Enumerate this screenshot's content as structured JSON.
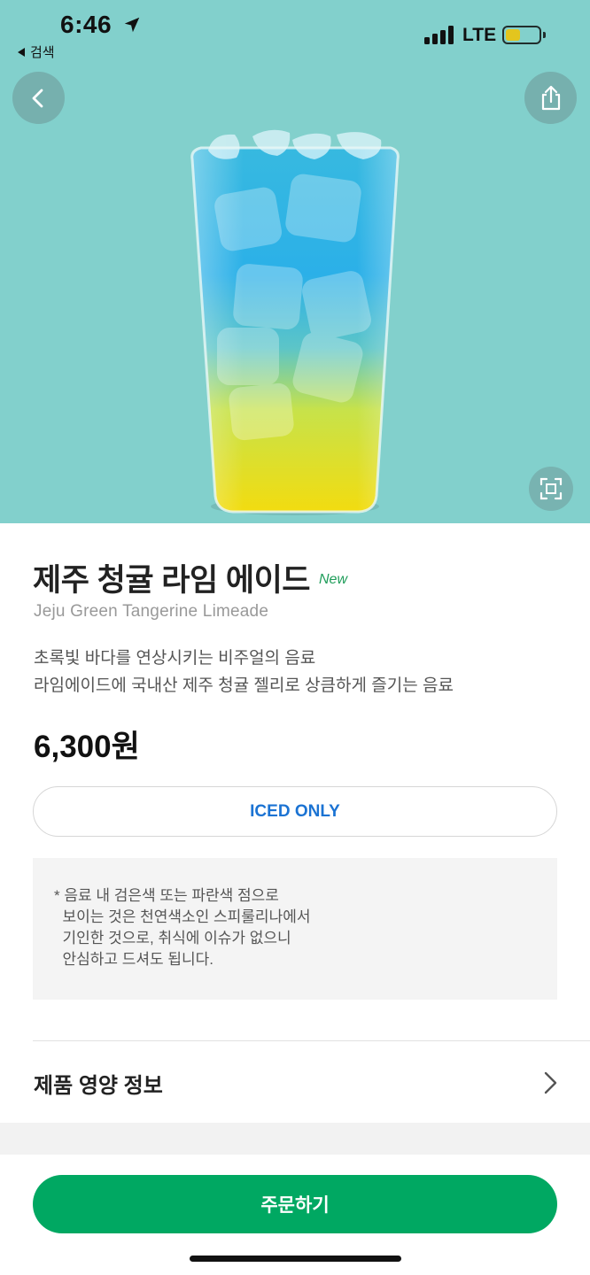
{
  "status_bar": {
    "time": "6:46",
    "back_app_label": "검색",
    "network": "LTE",
    "battery_level": 0.45,
    "battery_color": "#f5c400"
  },
  "header": {
    "back_icon": "chevron-left-icon",
    "share_icon": "share-icon",
    "zoom_icon": "fullscreen-icon",
    "hero_background": "#82d0cc"
  },
  "product": {
    "name_ko": "제주 청귤 라임 에이드",
    "badge": "New",
    "name_en": "Jeju Green Tangerine Limeade",
    "description_line1": "초록빛 바다를 연상시키는 비주얼의 음료",
    "description_line2": "라임에이드에 국내산 제주 청귤 젤리로 상큼하게 즐기는 음료",
    "price": "6,300원",
    "temperature_option": "ICED ONLY",
    "notice": "* 음료 내 검은색 또는 파란색 점으로\n  보이는 것은 천연색소인 스피룰리나에서\n  기인한 것으로, 취식에 이슈가 없으니\n  안심하고 드셔도 됩니다."
  },
  "nutrition": {
    "label": "제품 영양 정보",
    "chevron_icon": "chevron-right-icon"
  },
  "footer": {
    "order_button_label": "주문하기",
    "accent_color": "#00a862"
  }
}
